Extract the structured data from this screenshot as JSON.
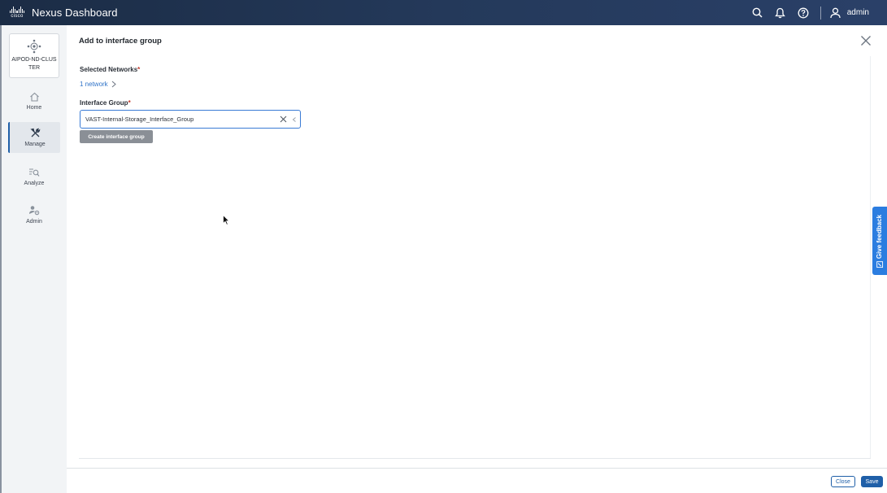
{
  "app": {
    "title": "Nexus Dashboard",
    "logo_text": "cisco"
  },
  "topbar": {
    "user": "admin",
    "icons": [
      "search-icon",
      "bell-icon",
      "help-icon",
      "user-icon"
    ]
  },
  "sidebar": {
    "cluster": {
      "name": "AIPOD-ND-CLUSTER"
    },
    "items": [
      {
        "label": "Home",
        "icon": "home-icon"
      },
      {
        "label": "Manage",
        "icon": "tools-icon",
        "active": true
      },
      {
        "label": "Analyze",
        "icon": "analyze-icon"
      },
      {
        "label": "Admin",
        "icon": "admin-icon"
      }
    ]
  },
  "dialog": {
    "title": "Add to interface group",
    "selected_networks_label": "Selected Networks",
    "selected_networks_value": "1 network",
    "interface_group_label": "Interface Group",
    "interface_group_value": "VAST-Internal-Storage_Interface_Group",
    "create_button": "Create interface group",
    "required_marker": "*"
  },
  "footer": {
    "close_label": "Close",
    "save_label": "Save"
  },
  "feedback": {
    "label": "Give feedback"
  },
  "colors": {
    "accent": "#1f5fa8",
    "link": "#2f73c8",
    "feedback": "#2b7de0",
    "topbar": "#1b2c45"
  }
}
